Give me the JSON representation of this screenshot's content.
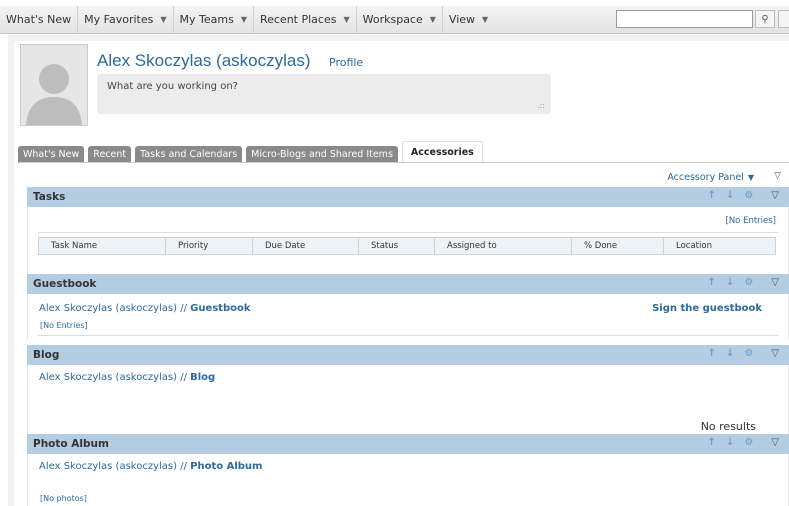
{
  "nav": {
    "items": [
      {
        "label": "What's New",
        "arrow": false
      },
      {
        "label": "My Favorites",
        "arrow": true
      },
      {
        "label": "My Teams",
        "arrow": true
      },
      {
        "label": "Recent Places",
        "arrow": true
      },
      {
        "label": "Workspace",
        "arrow": true
      },
      {
        "label": "View",
        "arrow": true
      }
    ],
    "search_placeholder": ""
  },
  "profile": {
    "name": "Alex Skoczylas (askoczylas)",
    "profile_link": "Profile",
    "status_placeholder": "What are you working on?"
  },
  "tabs": [
    {
      "label": "What's New",
      "active": false
    },
    {
      "label": "Recent",
      "active": false
    },
    {
      "label": "Tasks and Calendars",
      "active": false
    },
    {
      "label": "Micro-Blogs and Shared Items",
      "active": false
    },
    {
      "label": "Accessories",
      "active": true
    }
  ],
  "accessory_panel": {
    "label": "Accessory Panel"
  },
  "tasks": {
    "title": "Tasks",
    "no_entries": "[No Entries]",
    "columns": [
      "Task Name",
      "Priority",
      "Due Date",
      "Status",
      "Assigned to",
      "% Done",
      "Location"
    ]
  },
  "guestbook": {
    "title": "Guestbook",
    "owner": "Alex Skoczylas (askoczylas) // ",
    "section": "Guestbook",
    "sign": "Sign the guestbook",
    "no_entries": "[No Entries]"
  },
  "blog": {
    "title": "Blog",
    "owner": "Alex Skoczylas (askoczylas) // ",
    "section": "Blog",
    "no_results": "No results"
  },
  "photo": {
    "title": "Photo Album",
    "owner": "Alex Skoczylas (askoczylas) // ",
    "section": "Photo Album",
    "no_photos": "[No photos]"
  },
  "colors": {
    "accent": "#2b6a9d",
    "portlet_header": "#b5cde2",
    "tab_bg": "#8a8a8a"
  }
}
